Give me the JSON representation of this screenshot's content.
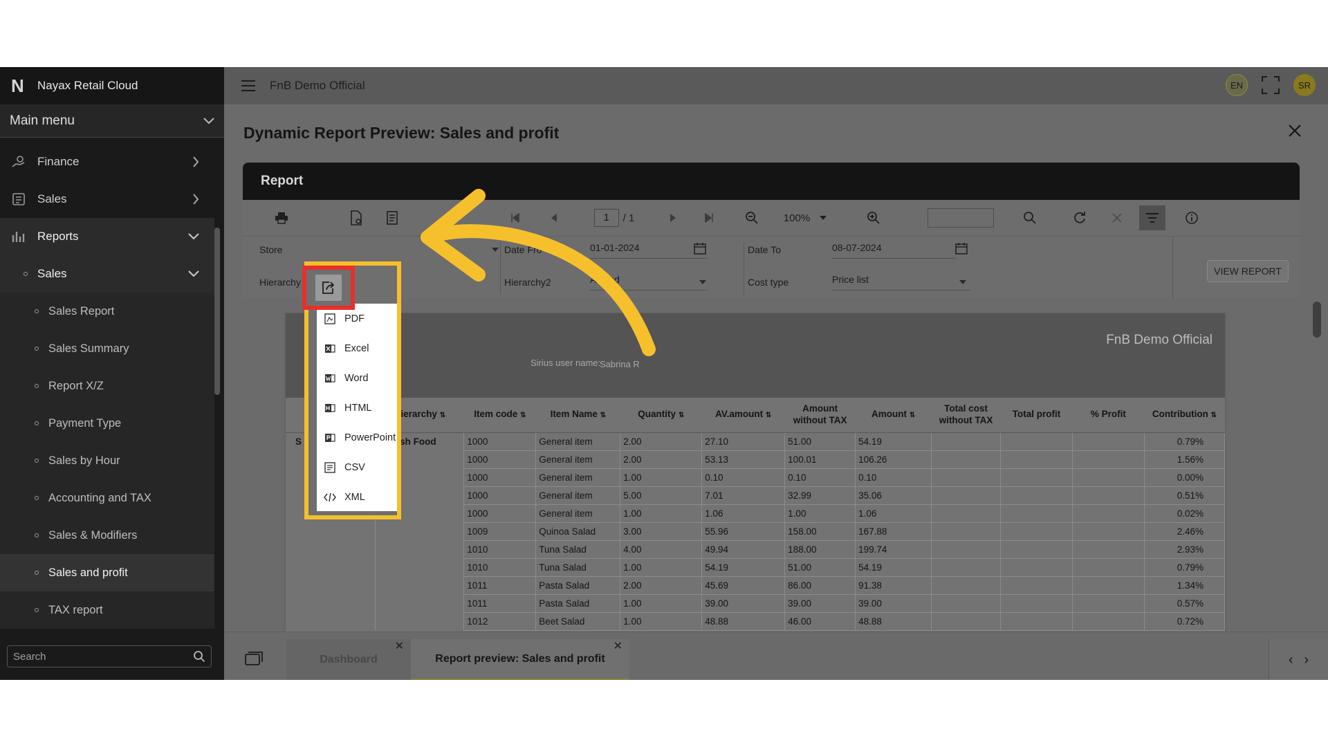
{
  "sidebar": {
    "brand_name": "Nayax Retail Cloud",
    "main_menu_label": "Main menu",
    "items": [
      {
        "label": "Finance"
      },
      {
        "label": "Sales"
      },
      {
        "label": "Reports"
      }
    ],
    "sub_group": "Sales",
    "leaves": [
      "Sales Report",
      "Sales Summary",
      "Report X/Z",
      "Payment Type",
      "Sales by Hour",
      "Accounting and TAX",
      "Sales & Modifiers",
      "Sales and profit",
      "TAX report"
    ],
    "active_leaf": "Sales and profit",
    "search_placeholder": "Search"
  },
  "topbar": {
    "company": "FnB Demo Official",
    "lang": "EN",
    "avatar": "SR"
  },
  "dialog": {
    "title": "Dynamic Report Preview: Sales and profit",
    "report_label": "Report"
  },
  "toolbar": {
    "page_current": "1",
    "page_total": "/ 1",
    "zoom": "100%"
  },
  "filters": {
    "store_label": "Store",
    "hierarchy_label": "Hierarchy",
    "date_from_label": "Date Fro",
    "date_from_value": "01-01-2024",
    "hierarchy2_label": "Hierarchy2",
    "hierarchy2_value": "Al        cted",
    "date_to_label": "Date To",
    "date_to_value": "08-07-2024",
    "cost_type_label": "Cost type",
    "cost_type_value": "Price list",
    "view_report_button": "VIEW REPORT"
  },
  "report": {
    "company": "FnB Demo Official",
    "user_label": "Sirius user name:",
    "user_value": "Sabrina R",
    "stray_s": "S",
    "hierarchy_value": "resh Food",
    "columns": [
      "Hierarchy",
      "Item code",
      "Item Name",
      "Quantity",
      "AV.amount",
      "Amount without TAX",
      "Amount",
      "Total cost without TAX",
      "Total profit",
      "% Profit",
      "Contribution"
    ],
    "rows": [
      [
        "1000",
        "General item",
        "2.00",
        "27.10",
        "51.00",
        "54.19",
        "",
        "",
        "",
        "0.79%"
      ],
      [
        "1000",
        "General item",
        "2.00",
        "53.13",
        "100.01",
        "106.26",
        "",
        "",
        "",
        "1.56%"
      ],
      [
        "1000",
        "General item",
        "1.00",
        "0.10",
        "0.10",
        "0.10",
        "",
        "",
        "",
        "0.00%"
      ],
      [
        "1000",
        "General item",
        "5.00",
        "7.01",
        "32.99",
        "35.06",
        "",
        "",
        "",
        "0.51%"
      ],
      [
        "1000",
        "General item",
        "1.00",
        "1.06",
        "1.00",
        "1.06",
        "",
        "",
        "",
        "0.02%"
      ],
      [
        "1009",
        "Quinoa Salad",
        "3.00",
        "55.96",
        "158.00",
        "167.88",
        "",
        "",
        "",
        "2.46%"
      ],
      [
        "1010",
        "Tuna Salad",
        "4.00",
        "49.94",
        "188.00",
        "199.74",
        "",
        "",
        "",
        "2.93%"
      ],
      [
        "1010",
        "Tuna Salad",
        "1.00",
        "54.19",
        "51.00",
        "54.19",
        "",
        "",
        "",
        "0.79%"
      ],
      [
        "1011",
        "Pasta Salad",
        "2.00",
        "45.69",
        "86.00",
        "91.38",
        "",
        "",
        "",
        "1.34%"
      ],
      [
        "1011",
        "Pasta Salad",
        "1.00",
        "39.00",
        "39.00",
        "39.00",
        "",
        "",
        "",
        "0.57%"
      ],
      [
        "1012",
        "Beet Salad",
        "1.00",
        "48.88",
        "46.00",
        "48.88",
        "",
        "",
        "",
        "0.72%"
      ]
    ]
  },
  "export_menu": {
    "items": [
      "PDF",
      "Excel",
      "Word",
      "HTML",
      "PowerPoint",
      "CSV",
      "XML"
    ]
  },
  "tabs": {
    "dashboard": "Dashboard",
    "active": "Report preview: Sales and profit"
  },
  "annotation_colors": {
    "highlight": "#f6c02d",
    "focus_box": "#e8302a"
  }
}
